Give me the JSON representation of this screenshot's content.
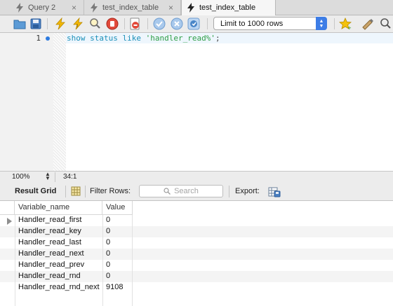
{
  "tabs": [
    {
      "label": "Query 2",
      "close": "×"
    },
    {
      "label": "test_index_table",
      "close": "×"
    },
    {
      "label": "test_index_table",
      "close": ""
    }
  ],
  "toolbar": {
    "limit_label": "Limit to 1000 rows",
    "icons": [
      "open-folder-icon",
      "save-icon",
      "execute-icon",
      "execute-current-icon",
      "explain-icon",
      "stop-icon",
      "toggle-error-icon",
      "commit-icon",
      "rollback-icon",
      "autocommit-icon",
      "limit-select",
      "favorite-icon",
      "beautify-icon",
      "find-icon"
    ]
  },
  "editor": {
    "line_number": "1",
    "code": {
      "keyword": "show status like ",
      "string": "'handler_read%'",
      "end": ";"
    }
  },
  "status": {
    "zoom": "100%",
    "position": "34:1"
  },
  "results": {
    "tab_label": "Result Grid",
    "filter_label": "Filter Rows:",
    "search_placeholder": "Search",
    "export_label": "Export:",
    "columns": [
      "Variable_name",
      "Value"
    ],
    "rows": [
      {
        "name": "Handler_read_first",
        "value": "0"
      },
      {
        "name": "Handler_read_key",
        "value": "0"
      },
      {
        "name": "Handler_read_last",
        "value": "0"
      },
      {
        "name": "Handler_read_next",
        "value": "0"
      },
      {
        "name": "Handler_read_prev",
        "value": "0"
      },
      {
        "name": "Handler_read_rnd",
        "value": "0"
      },
      {
        "name": "Handler_read_rnd_next",
        "value": "9108"
      }
    ]
  },
  "colors": {
    "accent": "#3d7de6",
    "keyword": "#1a8fb8",
    "string": "#2e9e46",
    "bolt": "#f2b705"
  }
}
